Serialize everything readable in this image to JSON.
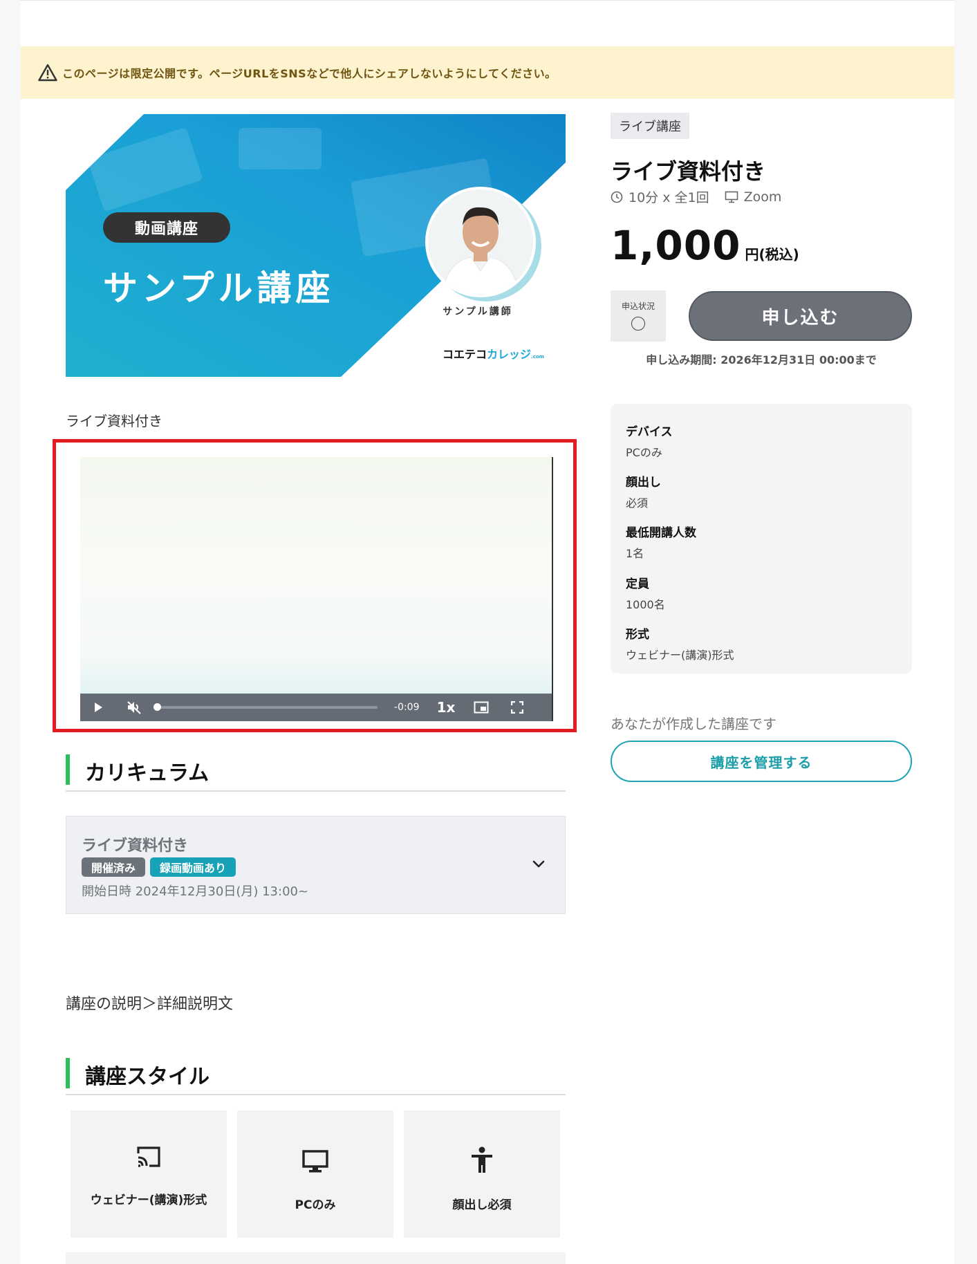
{
  "notice": {
    "text": "このページは限定公開です。ページURLをSNSなどで他人にシェアしないようにしてください。",
    "icon": "warning-icon"
  },
  "banner": {
    "badge": "動画講座",
    "title": "サンプル講座",
    "instructor": "サンプル講師",
    "brand_a": "コエテコ",
    "brand_b": "カレッジ",
    "brand_c": ".com"
  },
  "lesson_label": "ライブ資料付き",
  "video": {
    "time": "-0:09",
    "speed": "1x",
    "progress": 0.0
  },
  "curriculum": {
    "heading": "カリキュラム",
    "item_title": "ライブ資料付き",
    "tag_done": "開催済み",
    "tag_recording": "録画動画あり",
    "start": "開始日時 2024年12月30日(月) 13:00~"
  },
  "description": "講座の説明＞詳細説明文",
  "style": {
    "heading": "講座スタイル",
    "cards": [
      {
        "label": "ウェビナー(講演)形式",
        "icon": "cast-icon"
      },
      {
        "label": "PCのみ",
        "icon": "monitor-icon"
      },
      {
        "label": "顔出し必須",
        "icon": "person-icon"
      }
    ]
  },
  "course": {
    "category": "ライブ講座",
    "title": "ライブ資料付き",
    "duration": "10分 x 全1回",
    "tool": "Zoom",
    "price": "1,000",
    "price_unit": "円(税込)",
    "status_label": "申込状況",
    "apply_label": "申し込む",
    "period": "申し込み期間: 2026年12月31日 00:00まで"
  },
  "info": [
    {
      "key": "デバイス",
      "value": "PCのみ"
    },
    {
      "key": "顔出し",
      "value": "必須"
    },
    {
      "key": "最低開講人数",
      "value": "1名"
    },
    {
      "key": "定員",
      "value": "1000名"
    },
    {
      "key": "形式",
      "value": "ウェビナー(講演)形式"
    }
  ],
  "owner_note": "あなたが作成した講座です",
  "manage_label": "講座を管理する",
  "colors": {
    "accent_green": "#2bc05c",
    "teal": "#17a2b8",
    "notice_bg": "#fdf3cf",
    "alert_red": "#e01b22"
  }
}
